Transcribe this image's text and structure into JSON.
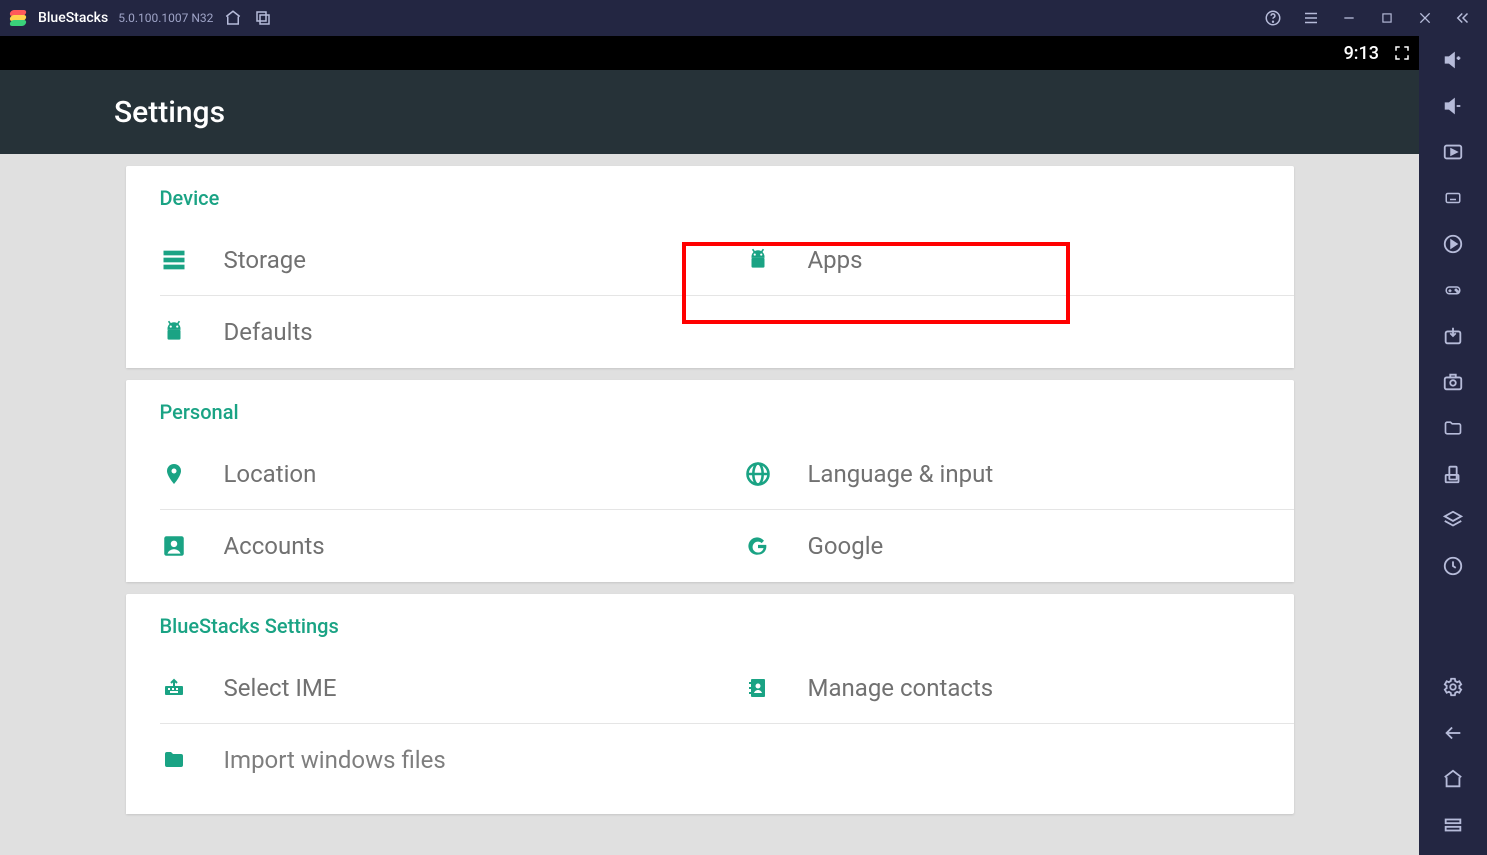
{
  "titlebar": {
    "brand": "BlueStacks",
    "version": "5.0.100.1007 N32"
  },
  "statusbar": {
    "time": "9:13"
  },
  "header": {
    "title": "Settings"
  },
  "sections": [
    {
      "title": "Device",
      "items": [
        {
          "icon": "storage",
          "label": "Storage"
        },
        {
          "icon": "android",
          "label": "Apps",
          "highlighted": true
        },
        {
          "icon": "android",
          "label": "Defaults"
        }
      ]
    },
    {
      "title": "Personal",
      "items": [
        {
          "icon": "location",
          "label": "Location"
        },
        {
          "icon": "globe",
          "label": "Language & input"
        },
        {
          "icon": "account",
          "label": "Accounts"
        },
        {
          "icon": "google",
          "label": "Google"
        }
      ]
    },
    {
      "title": "BlueStacks Settings",
      "items": [
        {
          "icon": "keyboard",
          "label": "Select IME"
        },
        {
          "icon": "contacts",
          "label": "Manage contacts"
        },
        {
          "icon": "folder",
          "label": "Import windows files"
        }
      ]
    }
  ],
  "side_tools": {
    "collapse": "collapse",
    "top": [
      "volume-up",
      "volume-down",
      "media",
      "keyboard",
      "record",
      "gamepad",
      "install-apk",
      "screenshot",
      "folder",
      "rotate",
      "layers",
      "clock"
    ],
    "bottom": [
      "gear",
      "back",
      "home",
      "recents"
    ]
  }
}
